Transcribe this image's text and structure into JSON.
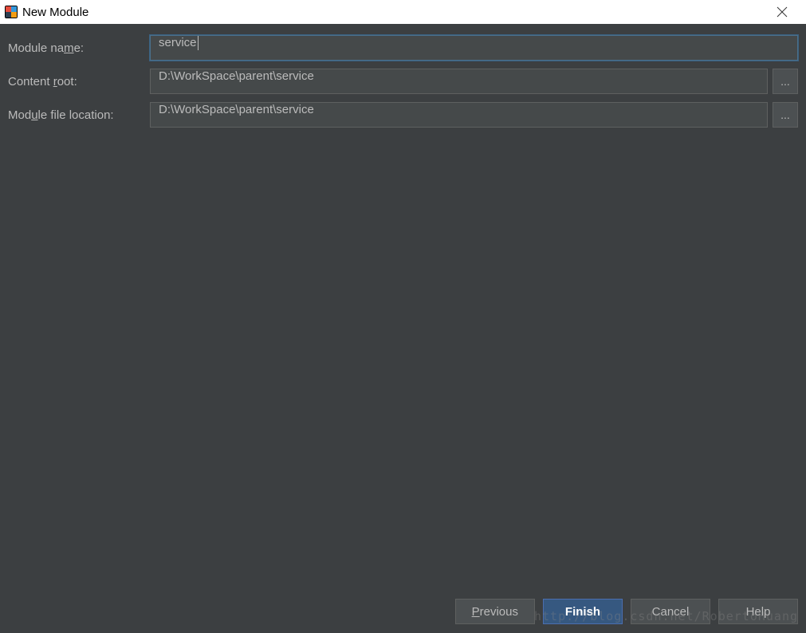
{
  "window": {
    "title": "New Module"
  },
  "form": {
    "module_name": {
      "label": "Module name:",
      "value": "service"
    },
    "content_root": {
      "label": "Content root:",
      "value": "D:\\WorkSpace\\parent\\service"
    },
    "module_file_location": {
      "label": "Module file location:",
      "value": "D:\\WorkSpace\\parent\\service"
    },
    "browse_label": "..."
  },
  "buttons": {
    "previous": "Previous",
    "finish": "Finish",
    "cancel": "Cancel",
    "help": "Help"
  },
  "watermark": "http://blog.csdn.net/RobertoHuang"
}
